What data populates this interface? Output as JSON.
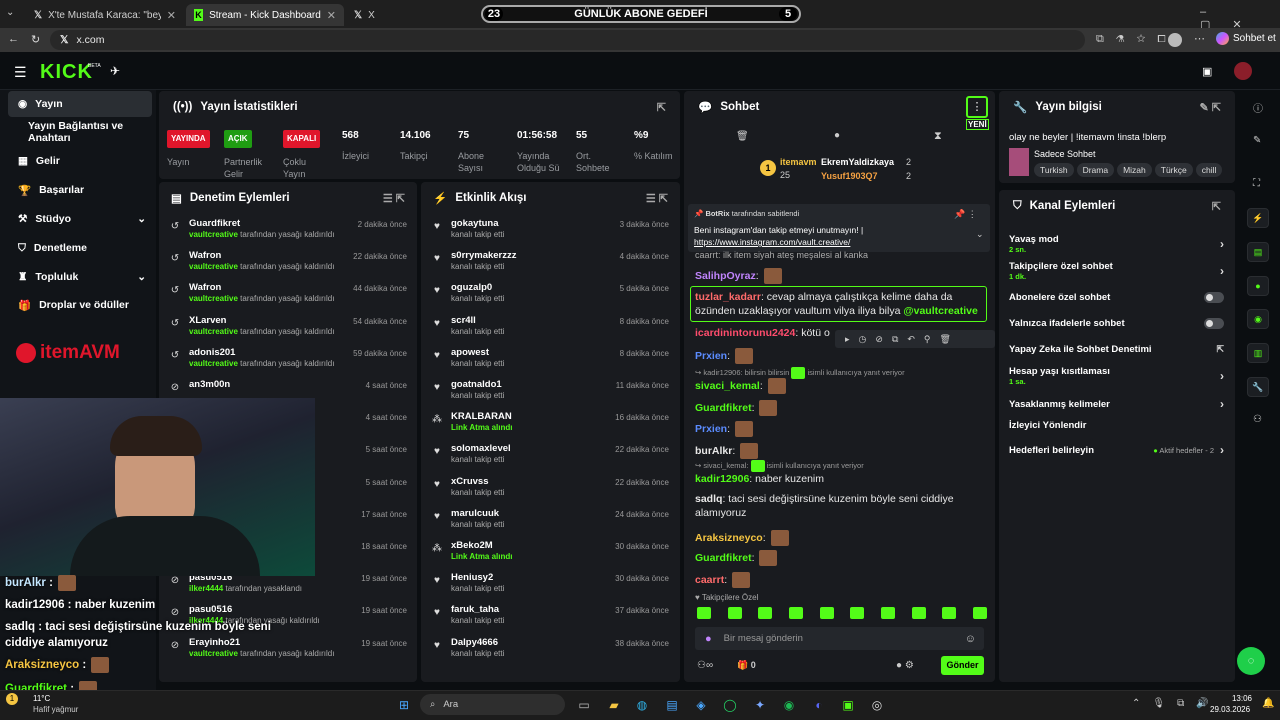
{
  "browser": {
    "tabs": [
      {
        "label": "X'te Mustafa Karaca: \"beyler elimd"
      },
      {
        "label": "Stream - Kick Dashboard"
      },
      {
        "label": "X"
      }
    ],
    "url": "x.com",
    "profile_label": "Sohbet et"
  },
  "goal": {
    "left": "23",
    "title": "GÜNLÜK ABONE GEDEFİ",
    "right": "5"
  },
  "sidebar": {
    "items": [
      {
        "label": "Yayın"
      },
      {
        "label": "Yayın Bağlantısı ve Anahtarı"
      },
      {
        "label": "Gelir"
      },
      {
        "label": "Başarılar"
      },
      {
        "label": "Stüdyo"
      },
      {
        "label": "Denetleme"
      },
      {
        "label": "Topluluk"
      },
      {
        "label": "Droplar ve ödüller"
      }
    ],
    "brand": "itemAVM"
  },
  "stats": {
    "title": "Yayın İstatistikleri",
    "items": [
      {
        "badge": "YAYINDA",
        "label": "Yayın"
      },
      {
        "badge": "AÇIK",
        "label": "Partnerlik Gelir"
      },
      {
        "badge": "KAPALI",
        "label": "Çoklu Yayın"
      },
      {
        "value": "568",
        "label": "İzleyici"
      },
      {
        "value": "14.106",
        "label": "Takipçi"
      },
      {
        "value": "75",
        "label": "Abone Sayısı"
      },
      {
        "value": "01:56:58",
        "label": "Yayında Olduğu Sü"
      },
      {
        "value": "55",
        "label": "Ort. Sohbete Katılan"
      },
      {
        "value": "%9",
        "label": "% Katılım"
      }
    ]
  },
  "moderation": {
    "title": "Denetim Eylemleri",
    "rows": [
      {
        "name": "Guardfikret",
        "actor": "vaultcreative",
        "action": "tarafından yasağı kaldırıldı",
        "time": "2 dakika önce"
      },
      {
        "name": "Wafron",
        "actor": "vaultcreative",
        "action": "tarafından yasağı kaldırıldı",
        "time": "22 dakika önce"
      },
      {
        "name": "Wafron",
        "actor": "vaultcreative",
        "action": "tarafından yasağı kaldırıldı",
        "time": "44 dakika önce"
      },
      {
        "name": "XLarven",
        "actor": "vaultcreative",
        "action": "tarafından yasağı kaldırıldı",
        "time": "54 dakika önce"
      },
      {
        "name": "adonis201",
        "actor": "vaultcreative",
        "action": "tarafından yasağı kaldırıldı",
        "time": "59 dakika önce"
      },
      {
        "name": "an3m00n",
        "actor": "",
        "action": "",
        "time": "4 saat önce"
      },
      {
        "name": "",
        "actor": "",
        "action": "ldı",
        "time": "4 saat önce"
      },
      {
        "name": "",
        "actor": "",
        "action": "",
        "time": "5 saat önce"
      },
      {
        "name": "",
        "actor": "",
        "action": "",
        "time": "5 saat önce"
      },
      {
        "name": "",
        "actor": "",
        "action": "",
        "time": "17 saat önce"
      },
      {
        "name": "",
        "actor": "",
        "action": "",
        "time": "18 saat önce"
      },
      {
        "name": "pasu0516",
        "actor": "ilker4444",
        "action": "tarafından yasaklandı",
        "time": "19 saat önce"
      },
      {
        "name": "pasu0516",
        "actor": "ilker4444",
        "action": "tarafından yasağı kaldırıldı",
        "time": "19 saat önce"
      },
      {
        "name": "Erayinho21",
        "actor": "vaultcreative",
        "action": "tarafından yasağı kaldırıldı",
        "time": "19 saat önce"
      }
    ]
  },
  "activity": {
    "title": "Etkinlik Akışı",
    "rows": [
      {
        "name": "gokaytuna",
        "sub": "kanalı takip etti",
        "time": "3 dakika önce"
      },
      {
        "name": "s0rrymakerzzz",
        "sub": "kanalı takip etti",
        "time": "4 dakika önce"
      },
      {
        "name": "oguzalp0",
        "sub": "kanalı takip etti",
        "time": "5 dakika önce"
      },
      {
        "name": "scr4ll",
        "sub": "kanalı takip etti",
        "time": "8 dakika önce"
      },
      {
        "name": "apowest",
        "sub": "kanalı takip etti",
        "time": "8 dakika önce"
      },
      {
        "name": "goatnaldo1",
        "sub": "kanalı takip etti",
        "time": "11 dakika önce"
      },
      {
        "name": "KRALBARAN",
        "sub": "Link Atma alındı",
        "time": "16 dakika önce"
      },
      {
        "name": "solomaxlevel",
        "sub": "kanalı takip etti",
        "time": "22 dakika önce"
      },
      {
        "name": "xCruvss",
        "sub": "kanalı takip etti",
        "time": "22 dakika önce"
      },
      {
        "name": "marulcuuk",
        "sub": "kanalı takip etti",
        "time": "24 dakika önce"
      },
      {
        "name": "xBeko2M",
        "sub": "Link Atma alındı",
        "time": "30 dakika önce"
      },
      {
        "name": "Heniusy2",
        "sub": "kanalı takip etti",
        "time": "30 dakika önce"
      },
      {
        "name": "faruk_taha",
        "sub": "kanalı takip etti",
        "time": "37 dakika önce"
      },
      {
        "name": "Dalpy4666",
        "sub": "kanalı takip etti",
        "time": "38 dakika önce"
      }
    ]
  },
  "chat": {
    "title": "Sohbet",
    "new_label": "YENİ",
    "top": {
      "user1": "itemavm",
      "user1_count": "25",
      "user2": "EkremYaldizkaya",
      "user2_count": "2",
      "user3": "Yusuf1903Q7",
      "user3_count": "2"
    },
    "pinned": {
      "by": "BotRix",
      "by_suffix": "tarafından sabitlendi",
      "text": "Beni instagram'dan takip etmeyi unutmayın! |",
      "link": "https://www.instagram.com/vault.creative/"
    },
    "partial": "caarrt: ilk item siyah ateş meşalesi al kanka",
    "messages": [
      {
        "user": "SalihpOyraz",
        "color": "#c084fc",
        "text": ""
      },
      {
        "user": "tuzlar_kadarr",
        "color": "#ff6b6b",
        "text": "cevap almaya çalıştıkça kelime daha da özünden uzaklaşıyor vaultum vilya iliya bilya ",
        "mention": "@vaultcreative"
      },
      {
        "user": "icardinintorunu2424",
        "color": "#ff4d6d",
        "text": "kötü o"
      },
      {
        "user": "Prxien",
        "color": "#5b8cff",
        "text": ""
      },
      {
        "user": "sivaci_kemal",
        "color": "#53fc18",
        "text": ""
      },
      {
        "user": "Guardfikret",
        "color": "#53fc18",
        "text": ""
      },
      {
        "user": "Prxien",
        "color": "#5b8cff",
        "text": ""
      },
      {
        "user": "burAlkr",
        "color": "#e8e8e8",
        "text": ""
      },
      {
        "user": "kadir12906",
        "color": "#53fc18",
        "text": "naber kuzenim"
      },
      {
        "user": "sadlq",
        "color": "#e8e8e8",
        "text": "taci sesi değiştirsüne kuzenim böyle seni ciddiye alamıyoruz"
      },
      {
        "user": "Araksizneyco",
        "color": "#f5c542",
        "text": ""
      },
      {
        "user": "Guardfikret",
        "color": "#53fc18",
        "text": ""
      },
      {
        "user": "caarrt",
        "color": "#ff6b6b",
        "text": ""
      }
    ],
    "reply1": "kadir12906: bilirsin bilirsin",
    "reply1_suffix": "isimli kullanıcıya yanıt veriyor",
    "reply2": "sivaci_kemal:",
    "reply2_suffix": "isimli kullanıcıya yanıt veriyor",
    "followers_only": "Takipçilere Özel",
    "input_placeholder": "Bir mesaj gönderin",
    "send_label": "Gönder",
    "footer_count": "0"
  },
  "stream_info": {
    "title": "Yayın bilgisi",
    "stream_title": "olay ne beyler | !itemavm !insta !blerp",
    "category": "Sadece Sohbet",
    "tags": [
      "Turkish",
      "Drama",
      "Mizah",
      "Türkçe",
      "chill"
    ]
  },
  "channel_actions": {
    "title": "Kanal Eylemleri",
    "items": [
      {
        "label": "Yavaş mod",
        "sub": "2 sn.",
        "control": "chevron"
      },
      {
        "label": "Takipçilere özel sohbet",
        "sub": "1 dk.",
        "control": "chevron"
      },
      {
        "label": "Abonelere özel sohbet",
        "sub": "",
        "control": "toggle"
      },
      {
        "label": "Yalnızca ifadelerle sohbet",
        "sub": "",
        "control": "toggle"
      },
      {
        "label": "Yapay Zeka ile Sohbet Denetimi",
        "sub": "",
        "control": "external"
      },
      {
        "label": "Hesap yaşı kısıtlaması",
        "sub": "1 sa.",
        "control": "chevron"
      },
      {
        "label": "Yasaklanmış kelimeler",
        "sub": "",
        "control": "chevron"
      },
      {
        "label": "İzleyici Yönlendir",
        "sub": "",
        "control": "none"
      },
      {
        "label": "Hedefleri belirleyin",
        "sub": "",
        "control": "chevron",
        "extra": "Aktif hedefler - 2"
      }
    ]
  },
  "overlay_chat": [
    {
      "user": "burAlkr",
      "text": ""
    },
    {
      "user": "kadir12906",
      "text": "naber kuzenim"
    },
    {
      "user": "sadlq",
      "text": "taci sesi değiştirsüne kuzenim böyle seni ciddiye alamıyoruz"
    },
    {
      "user": "Araksizneyco",
      "text": ""
    },
    {
      "user": "Guardfikret",
      "text": ""
    }
  ],
  "taskbar": {
    "search": "Ara",
    "weather_temp": "11°C",
    "weather_text": "Hafif yağmur",
    "time": "13:06",
    "date": "29.03.2026"
  },
  "colors": {
    "accent": "#53fc18",
    "live": "#e0162b",
    "on": "#53fc18",
    "off": "#e0162b"
  }
}
